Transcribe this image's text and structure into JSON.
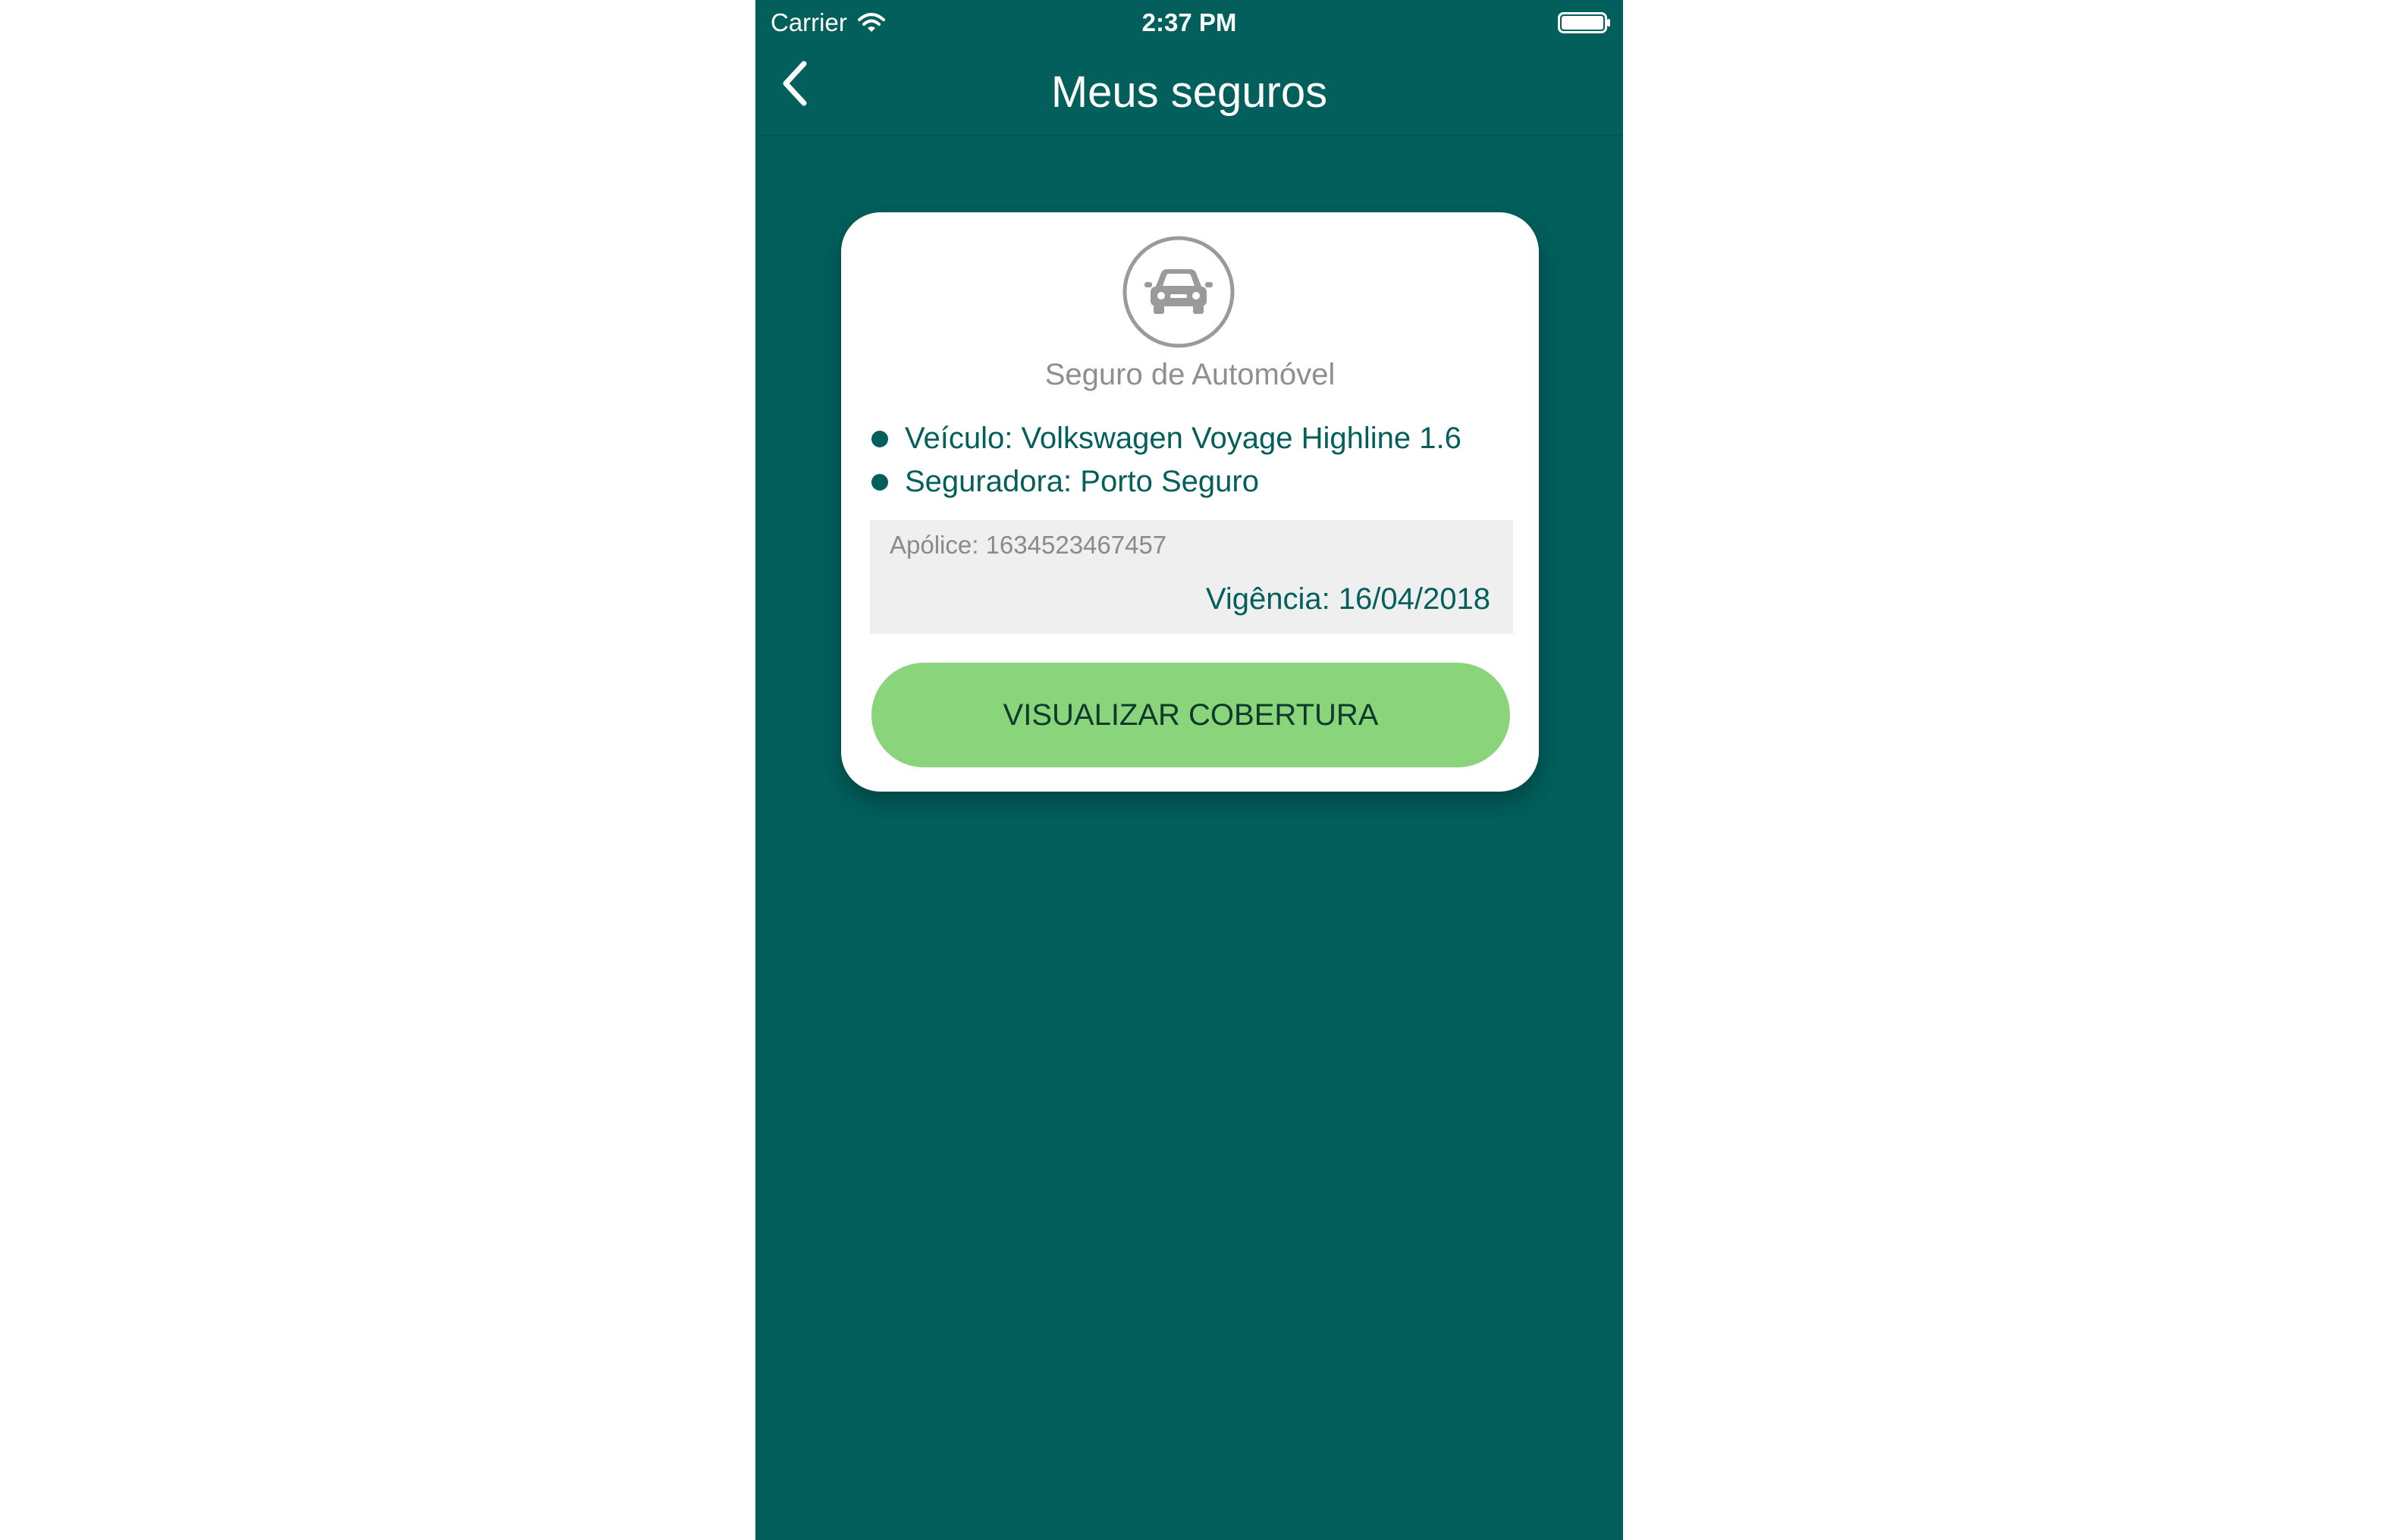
{
  "status_bar": {
    "carrier": "Carrier",
    "time": "2:37 PM",
    "icons": [
      "wifi-icon",
      "battery-icon"
    ]
  },
  "nav": {
    "title": "Meus seguros",
    "back_icon": "chevron-left-icon"
  },
  "card": {
    "icon": "car-icon",
    "title": "Seguro de Automóvel",
    "items": [
      {
        "label": "Veículo: Volkswagen Voyage Highline 1.6"
      },
      {
        "label": "Seguradora: Porto Seguro"
      }
    ],
    "policy": "Apólice: 1634523467457",
    "validity": "Vigência: 16/04/2018",
    "button_label": "VISUALIZAR COBERTURA"
  },
  "colors": {
    "primary": "#025f5c",
    "accent": "#8ad57c",
    "muted_text": "#8f8f8f",
    "policy_bg": "#efefef"
  }
}
